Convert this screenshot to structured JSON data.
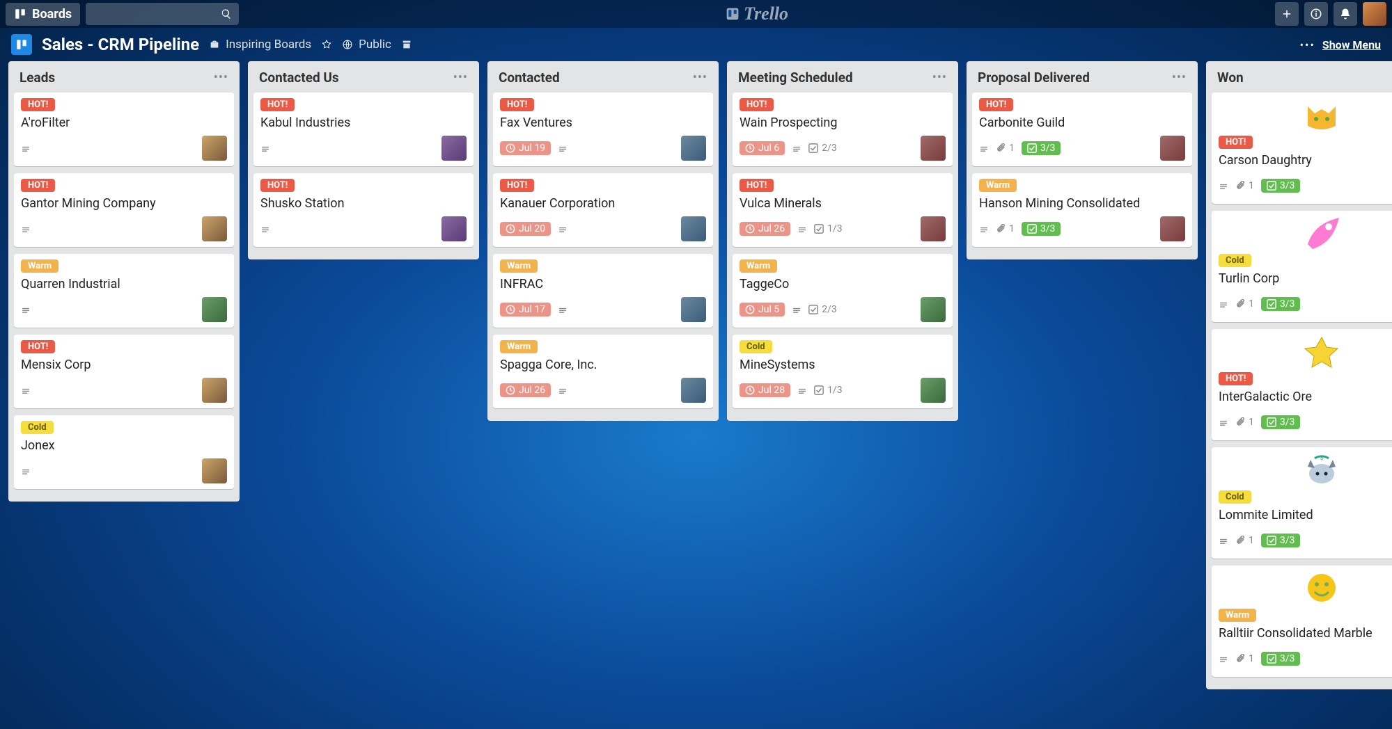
{
  "topbar": {
    "boards_label": "Boards",
    "logo_text": "Trello"
  },
  "boardbar": {
    "title": "Sales - CRM Pipeline",
    "inspiring": "Inspiring Boards",
    "visibility": "Public",
    "show_menu": "Show Menu"
  },
  "labels": {
    "hot": "HOT!",
    "warm": "Warm",
    "cold": "Cold"
  },
  "lists": [
    {
      "title": "Leads",
      "cards": [
        {
          "label": "hot",
          "title": "A'roFilter",
          "desc": true,
          "avatar": "av1"
        },
        {
          "label": "hot",
          "title": "Gantor Mining Company",
          "desc": true,
          "avatar": "av1"
        },
        {
          "label": "warm",
          "title": "Quarren Industrial",
          "desc": true,
          "avatar": "av2"
        },
        {
          "label": "hot",
          "title": "Mensix Corp",
          "desc": true,
          "avatar": "av1"
        },
        {
          "label": "cold",
          "title": "Jonex",
          "desc": true,
          "avatar": "av1"
        }
      ]
    },
    {
      "title": "Contacted Us",
      "cards": [
        {
          "label": "hot",
          "title": "Kabul Industries",
          "desc": true,
          "avatar": "av3"
        },
        {
          "label": "hot",
          "title": "Shusko Station",
          "desc": true,
          "avatar": "av3"
        }
      ]
    },
    {
      "title": "Contacted",
      "cards": [
        {
          "label": "hot",
          "title": "Fax Ventures",
          "due": "Jul 19",
          "desc": true,
          "avatar": "av4"
        },
        {
          "label": "hot",
          "title": "Kanauer Corporation",
          "due": "Jul 20",
          "desc": true,
          "avatar": "av4"
        },
        {
          "label": "warm",
          "title": "INFRAC",
          "due": "Jul 17",
          "desc": true,
          "avatar": "av4"
        },
        {
          "label": "warm",
          "title": "Spagga Core, Inc.",
          "due": "Jul 26",
          "desc": true,
          "avatar": "av4"
        }
      ]
    },
    {
      "title": "Meeting Scheduled",
      "cards": [
        {
          "label": "hot",
          "title": "Wain Prospecting",
          "due": "Jul 6",
          "desc": true,
          "checklist": "2/3",
          "avatar": "av5"
        },
        {
          "label": "hot",
          "title": "Vulca Minerals",
          "due": "Jul 26",
          "desc": true,
          "checklist": "1/3",
          "avatar": "av5"
        },
        {
          "label": "warm",
          "title": "TaggeCo",
          "due": "Jul 5",
          "desc": true,
          "checklist": "2/3",
          "avatar": "av2"
        },
        {
          "label": "cold",
          "title": "MineSystems",
          "due": "Jul 28",
          "desc": true,
          "checklist": "1/3",
          "avatar": "av2"
        }
      ]
    },
    {
      "title": "Proposal Delivered",
      "cards": [
        {
          "label": "hot",
          "title": "Carbonite Guild",
          "desc": true,
          "attach": "1",
          "checklist_done": "3/3",
          "avatar": "av5"
        },
        {
          "label": "warm",
          "title": "Hanson Mining Consolidated",
          "desc": true,
          "attach": "1",
          "checklist_done": "3/3",
          "avatar": "av5"
        }
      ]
    },
    {
      "title": "Won",
      "cards": [
        {
          "sticker": "cat",
          "label": "hot",
          "title": "Carson Daughtry",
          "desc": true,
          "attach": "1",
          "checklist_done": "3/3",
          "avatar": "av3"
        },
        {
          "sticker": "rocket",
          "label": "cold",
          "title": "Turlin Corp",
          "desc": true,
          "attach": "1",
          "checklist_done": "3/3",
          "avatar": "av3"
        },
        {
          "sticker": "star",
          "label": "hot",
          "title": "InterGalactic Ore",
          "desc": true,
          "attach": "1",
          "checklist_done": "3/3",
          "avatar": "av3"
        },
        {
          "sticker": "husky",
          "label": "cold",
          "title": "Lommite Limited",
          "desc": true,
          "attach": "1",
          "checklist_done": "3/3",
          "avatar": "av3"
        },
        {
          "sticker": "smile",
          "label": "warm",
          "title": "Ralltiir Consolidated Marble",
          "desc": true,
          "attach": "1",
          "checklist_done": "3/3",
          "avatar": "av3"
        }
      ]
    }
  ]
}
